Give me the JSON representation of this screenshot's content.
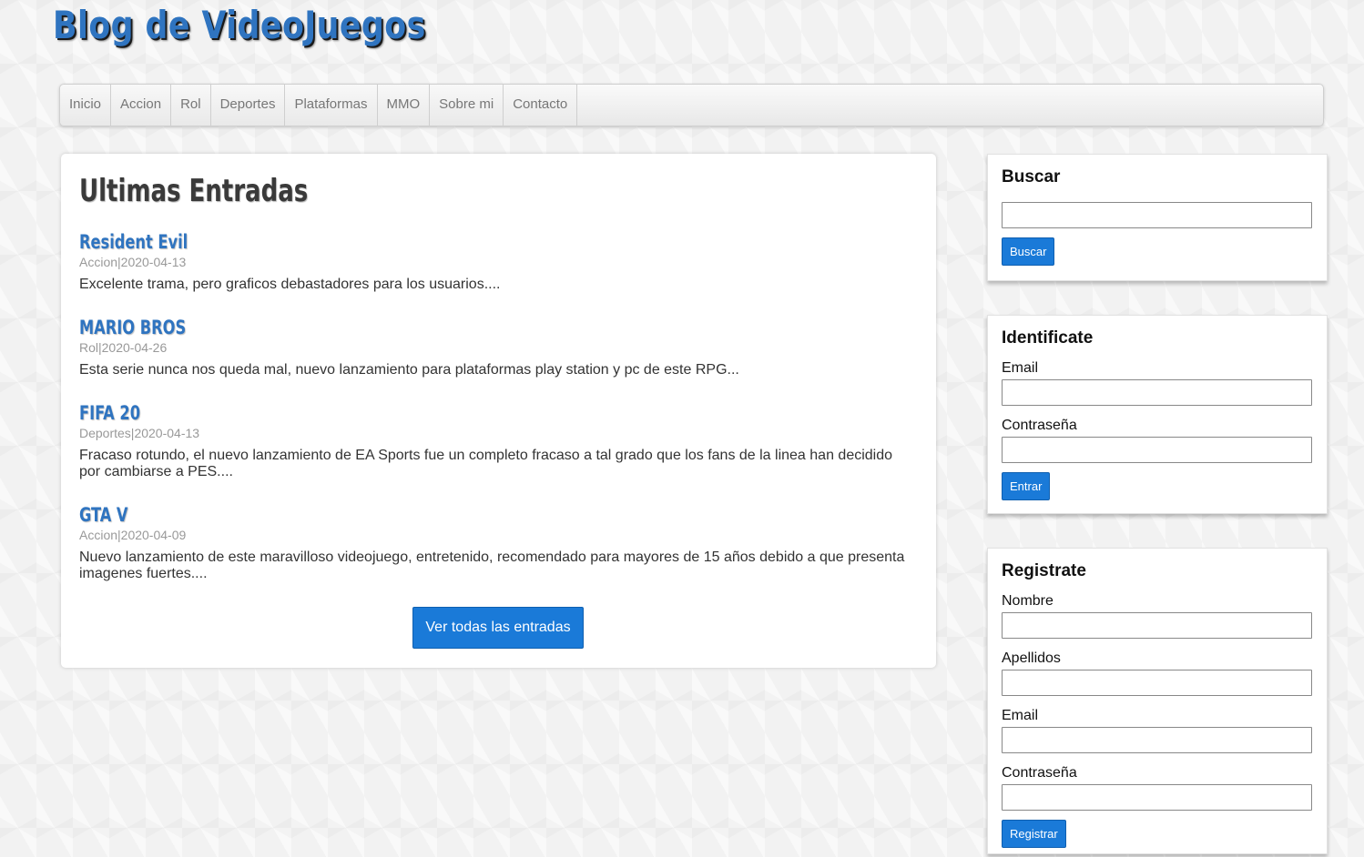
{
  "site_title": "Blog de VideoJuegos",
  "nav": [
    "Inicio",
    "Accion",
    "Rol",
    "Deportes",
    "Plataformas",
    "MMO",
    "Sobre mi",
    "Contacto"
  ],
  "main": {
    "title": "Ultimas Entradas",
    "entries": [
      {
        "title": "Resident Evil",
        "meta": "Accion|2020-04-13",
        "body": "Excelente trama, pero graficos debastadores para los usuarios...."
      },
      {
        "title": "MARIO BROS",
        "meta": "Rol|2020-04-26",
        "body": "Esta serie nunca nos queda mal, nuevo lanzamiento para plataformas play station y pc de este RPG..."
      },
      {
        "title": "FIFA 20",
        "meta": "Deportes|2020-04-13",
        "body": "Fracaso rotundo, el nuevo lanzamiento de EA Sports fue un completo fracaso a tal grado que los fans de la linea han decidido por cambiarse a PES...."
      },
      {
        "title": "GTA V",
        "meta": "Accion|2020-04-09",
        "body": "Nuevo lanzamiento de este maravilloso videojuego, entretenido, recomendado para mayores de 15 años debido a que presenta imagenes fuertes...."
      }
    ],
    "view_all_label": "Ver todas las entradas"
  },
  "search": {
    "title": "Buscar",
    "value": "",
    "button": "Buscar"
  },
  "login": {
    "title": "Identificate",
    "email_label": "Email",
    "password_label": "Contraseña",
    "button": "Entrar"
  },
  "register": {
    "title": "Registrate",
    "name_label": "Nombre",
    "surname_label": "Apellidos",
    "email_label": "Email",
    "password_label": "Contraseña",
    "button": "Registrar"
  },
  "colors": {
    "accent": "#1a7ad8",
    "title_blue": "#2f74c0"
  }
}
